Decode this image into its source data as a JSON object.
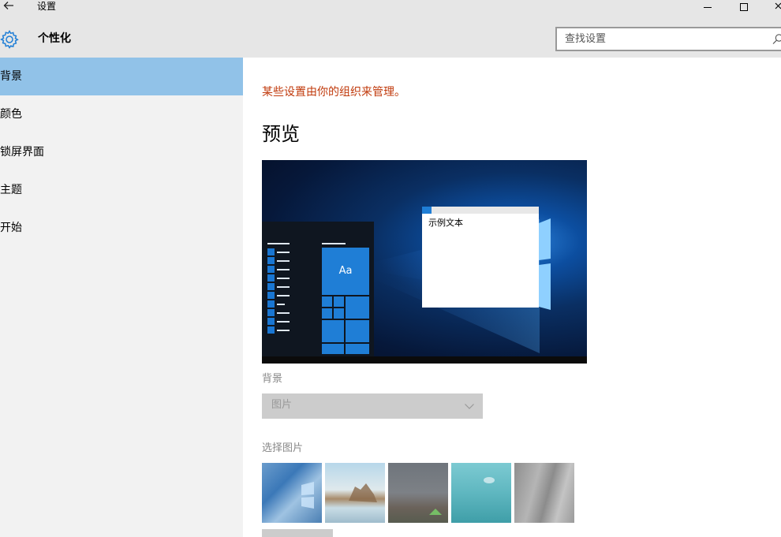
{
  "titlebar": {
    "back_icon": "back-arrow-icon",
    "title": "设置",
    "controls": [
      "minimize-icon",
      "maximize-icon",
      "close-icon"
    ]
  },
  "header": {
    "icon": "gear-icon",
    "page_title": "个性化",
    "search_placeholder": "查找设置",
    "search_icon": "search-icon"
  },
  "sidebar": {
    "items": [
      {
        "label": "背景",
        "active": true
      },
      {
        "label": "颜色",
        "active": false
      },
      {
        "label": "锁屏界面",
        "active": false
      },
      {
        "label": "主题",
        "active": false
      },
      {
        "label": "开始",
        "active": false
      }
    ]
  },
  "main": {
    "notice": "某些设置由你的组织来管理。",
    "preview_title": "预览",
    "preview": {
      "tile_text": "Aa",
      "window_text": "示例文本"
    },
    "background_label": "背景",
    "background_value": "图片",
    "choose_picture_label": "选择图片",
    "thumbnails": [
      "windows-hero-blue",
      "beach-rocks",
      "night-sky-tent",
      "underwater-swimmer",
      "gray-rock"
    ]
  },
  "colors": {
    "accent": "#1f7ed6",
    "sidebar_active": "#91c2e8",
    "notice": "#c0390b",
    "chrome": "#e6e6e6",
    "sidebar_bg": "#f2f2f2"
  }
}
